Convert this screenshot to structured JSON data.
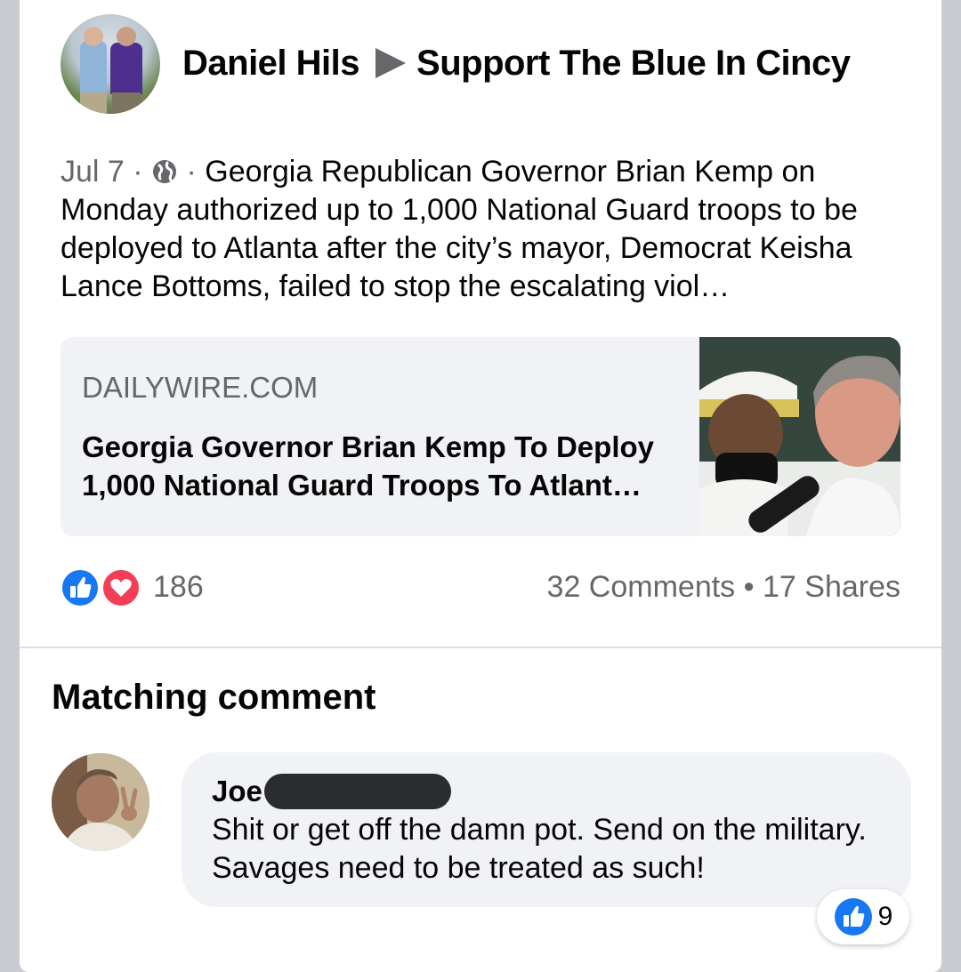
{
  "post": {
    "author": "Daniel Hils",
    "group": "Support The Blue In Cincy",
    "date": "Jul 7",
    "privacy_icon": "globe-icon",
    "text": "Georgia Republican Governor Brian Kemp on Monday authorized up to 1,000 National Guard troops to be deployed to Atlanta after the city’s mayor, Democrat Keisha Lance Bottoms, failed to stop the escalating viol…"
  },
  "link_preview": {
    "domain": "DAILYWIRE.COM",
    "title": "Georgia Governor Brian Kemp To Deploy 1,000 National Guard Troops To Atlant…"
  },
  "engagement": {
    "reaction_icons": [
      "like-icon",
      "love-icon"
    ],
    "reaction_count": "186",
    "comments": "32 Comments",
    "separator": "•",
    "shares": "17 Shares"
  },
  "matching_comment": {
    "section_title": "Matching comment",
    "author": "Joe",
    "text": "Shit or get off the damn pot. Send on the military. Savages need to be treated as such!",
    "reaction_icon": "like-icon",
    "reaction_count": "9"
  },
  "colors": {
    "background": "#c9ccd1",
    "card": "#ffffff",
    "bubble": "#f0f2f5",
    "secondary_text": "#65676b",
    "like_blue": "#1877f2",
    "love_red": "#f33e58"
  }
}
